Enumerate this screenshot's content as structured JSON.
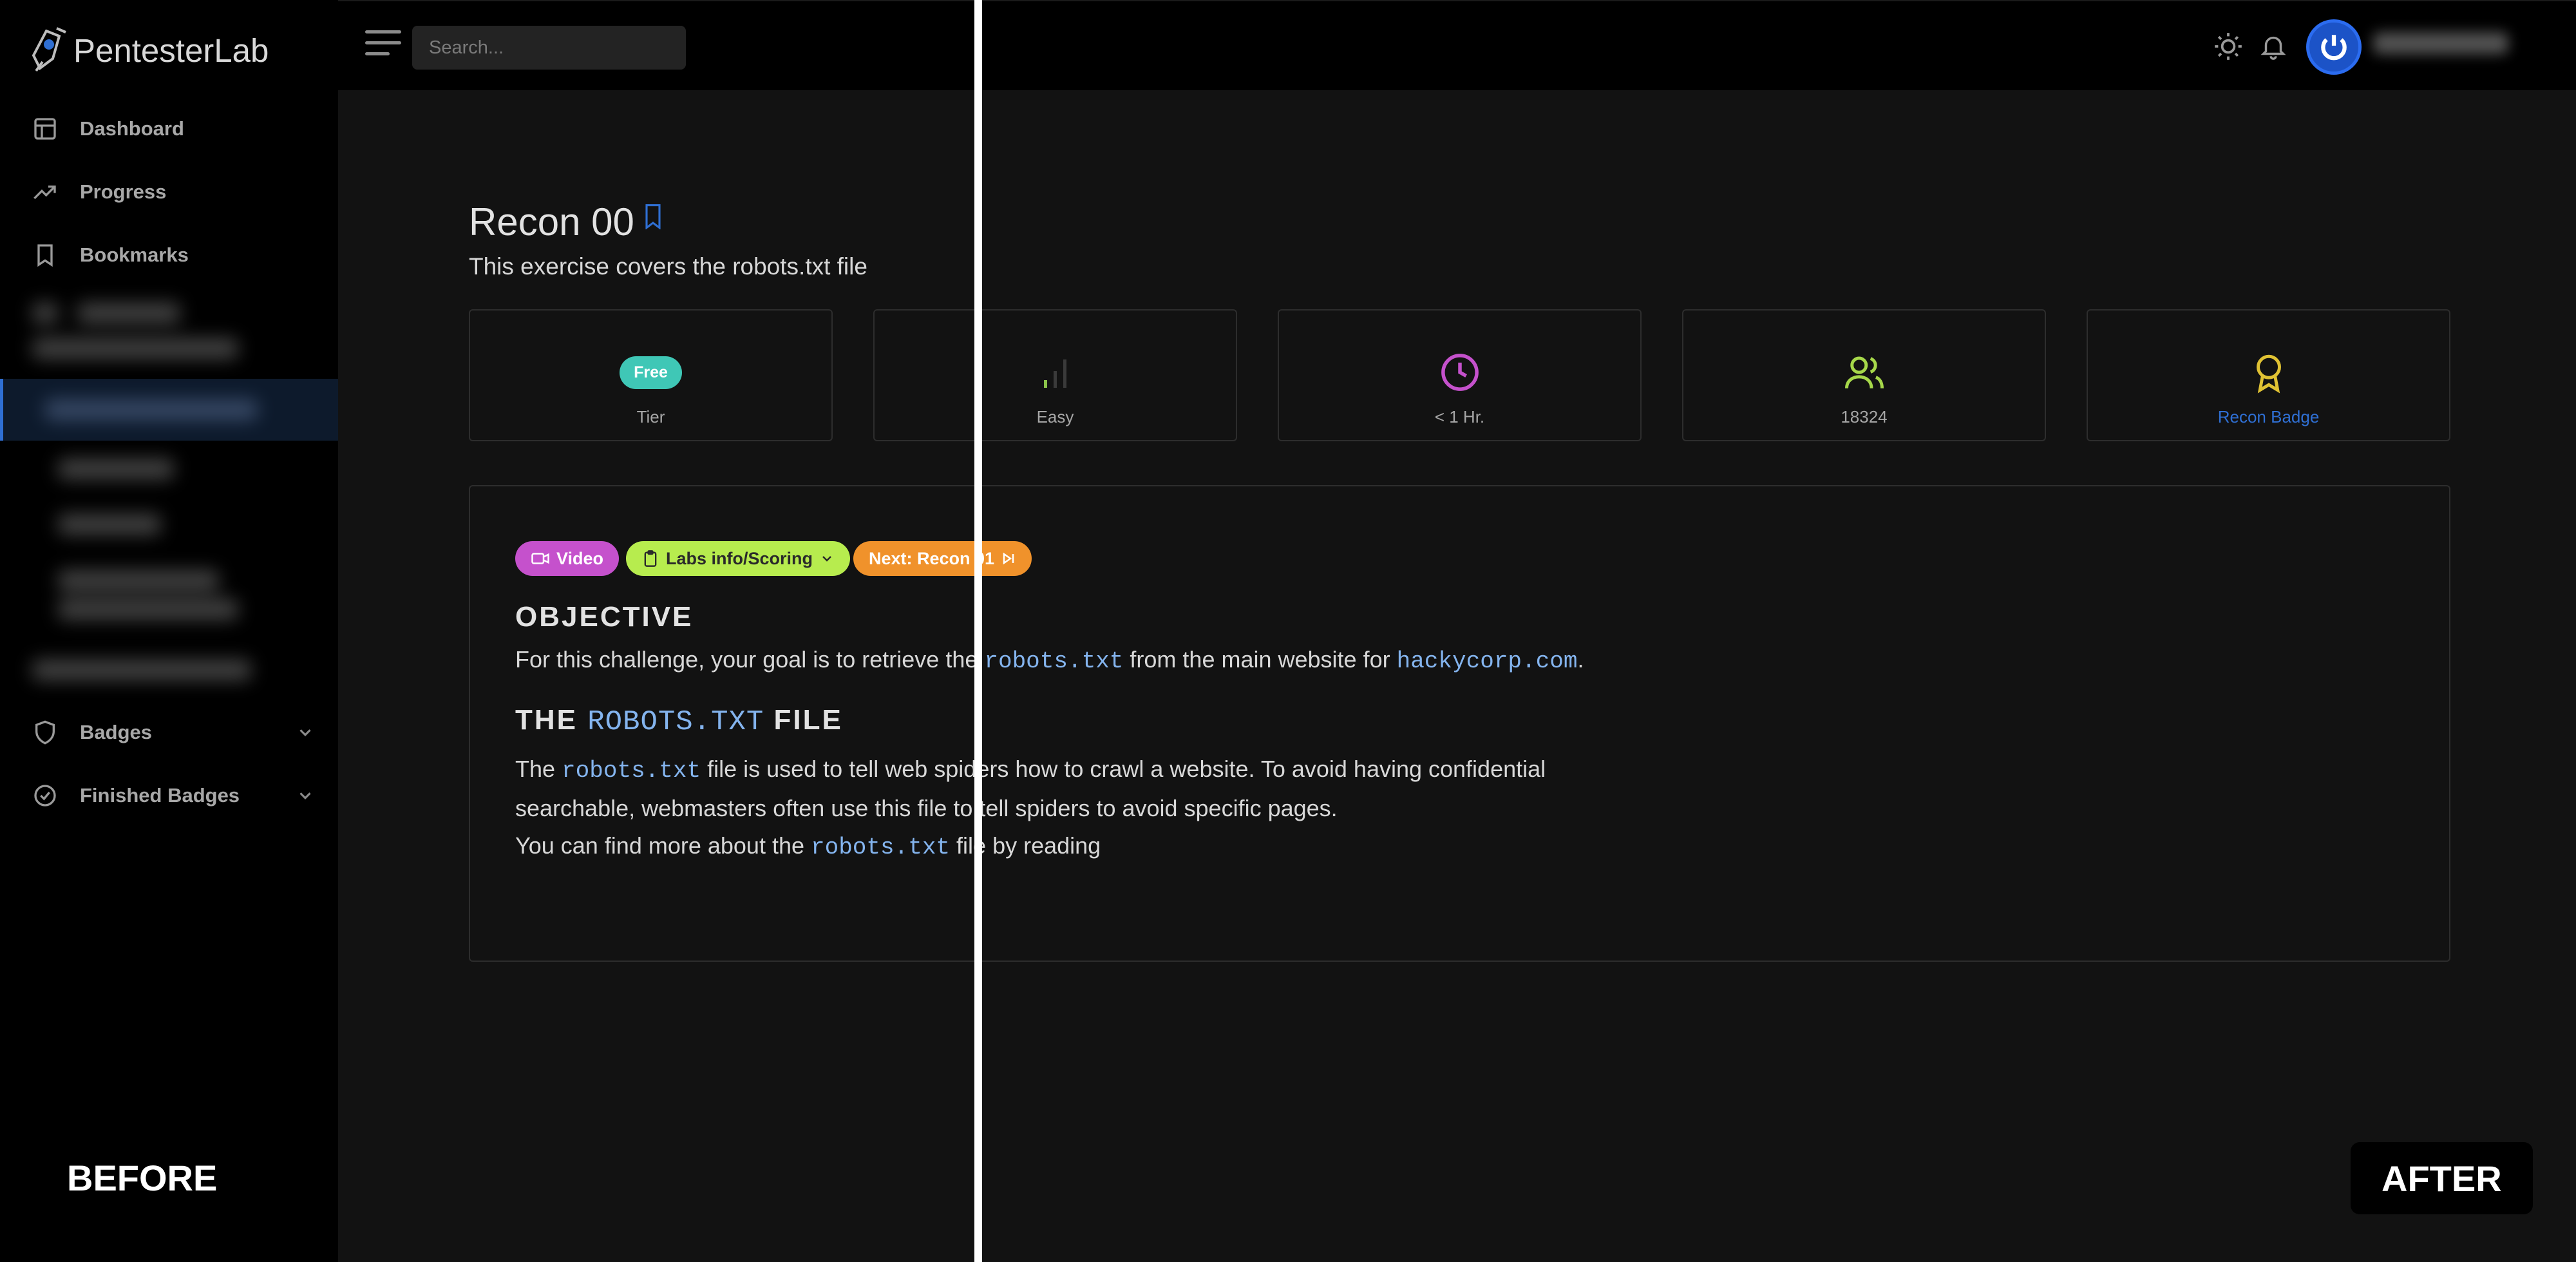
{
  "app": {
    "name": "PentesterLab"
  },
  "sidebar": {
    "items": [
      {
        "label": "Dashboard",
        "icon": "dashboard-icon"
      },
      {
        "label": "Progress",
        "icon": "trending-up-icon"
      },
      {
        "label": "Bookmarks",
        "icon": "bookmark-icon"
      },
      {
        "label": "Badges",
        "icon": "shield-icon"
      },
      {
        "label": "Finished Badges",
        "icon": "check-circle-icon"
      }
    ]
  },
  "topbar": {
    "search_placeholder": "Search...",
    "icons": [
      "menu-icon",
      "sun-icon",
      "bell-icon",
      "power-icon"
    ]
  },
  "exercise": {
    "title": "Recon 00",
    "subtitle": "This exercise covers the robots.txt file",
    "stats": {
      "tier_pill": "Free",
      "tier_label": "Tier",
      "difficulty": "Easy",
      "duration": "< 1 Hr.",
      "students": "18324",
      "badge": "Recon Badge"
    },
    "pills": {
      "video": "Video",
      "labs": "Labs info/Scoring",
      "next": "Next: Recon 01"
    },
    "objective": {
      "heading": "OBJECTIVE",
      "text_1": "For this challenge, your goal is to retrieve the ",
      "code_1": "robots.txt",
      "text_2": " from the main website for ",
      "code_2": "hackycorp.com",
      "text_3": "."
    },
    "robots_section": {
      "heading_1": "THE ",
      "heading_code": "ROBOTS.TXT",
      "heading_2": " FILE",
      "l1_a": "The ",
      "l1_code": "robots.txt",
      "l1_b": " file is used to tell web spiders how to crawl a website. To avoid having confidential",
      "l2": "searchable, webmasters often use this file to tell spiders to avoid specific pages.",
      "l3_a": "You can find more about the ",
      "l3_code": "robots.txt",
      "l3_b": " file by reading"
    }
  },
  "comparison": {
    "before": "BEFORE",
    "after": "AFTER"
  },
  "colors": {
    "accent_blue": "#2f6fd3",
    "tier_teal": "#3fc7b6",
    "video_purple": "#c551cc",
    "labs_green": "#b7ec4e",
    "next_orange": "#f0922b",
    "code_blue": "#84b4ee"
  }
}
